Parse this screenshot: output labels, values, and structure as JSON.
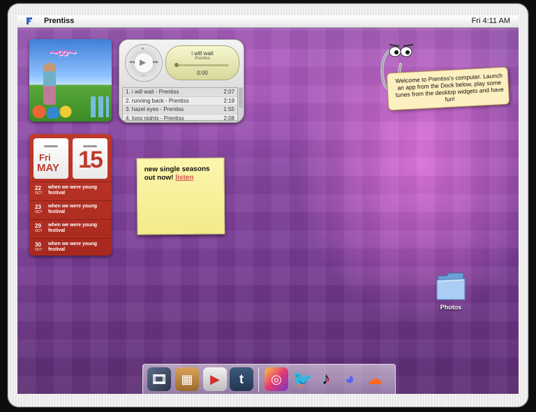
{
  "menubar": {
    "app_name": "Prentiss",
    "clock": "Fri 4:11 AM"
  },
  "music_player": {
    "now_playing_title": "i will wait",
    "now_playing_artist": "Prentiss",
    "elapsed": "0:00",
    "tracks": [
      {
        "name": "1. i will wait - Prentiss",
        "duration": "2:07"
      },
      {
        "name": "2. running back - Prentiss",
        "duration": "2:19"
      },
      {
        "name": "3. hazel eyes - Prentiss",
        "duration": "1:55"
      },
      {
        "name": "4. long nights - Prentiss",
        "duration": "2:08"
      }
    ]
  },
  "calendar": {
    "weekday": "Fri",
    "month": "MAY",
    "day": "15",
    "events": [
      {
        "day": "22",
        "month": "OCT",
        "name": "when we were young festival"
      },
      {
        "day": "23",
        "month": "OCT",
        "name": "when we were young festival"
      },
      {
        "day": "29",
        "month": "OCT",
        "name": "when we were young festival"
      },
      {
        "day": "30",
        "month": "OCT",
        "name": "when we were young festival"
      }
    ]
  },
  "sticky_note": {
    "text": "new single seasons out now!",
    "link": "listen"
  },
  "assistant": {
    "message": "Welcome to Prentiss's computer. Launch an app from the Dock below, play some tunes from the desktop widgets and have fun!"
  },
  "desktop": {
    "folder_label": "Photos"
  },
  "dock": {
    "apps": [
      "film-app",
      "store-app",
      "video-app",
      "tumblr-app",
      "instagram-app",
      "twitter-app",
      "tiktok-app",
      "discord-app",
      "soundcloud-app"
    ]
  },
  "colors": {
    "calendar_red": "#c0392b",
    "sticky_yellow": "#fcf7ae",
    "wallpaper_purple": "#8d4aa7"
  }
}
